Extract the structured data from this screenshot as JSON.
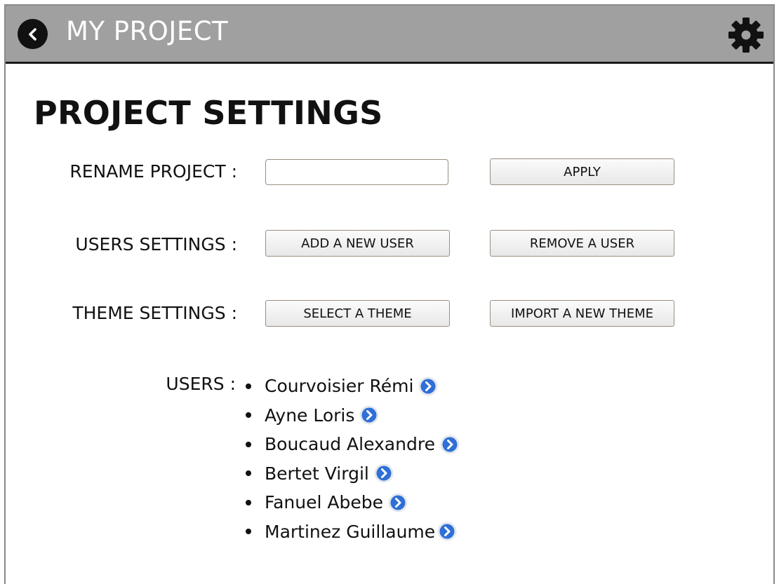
{
  "header": {
    "title": "MY PROJECT",
    "back_icon": "chevron-left-circle-icon",
    "settings_icon": "gear-icon"
  },
  "page": {
    "title": "PROJECT SETTINGS"
  },
  "rename": {
    "label": "RENAME PROJECT :",
    "input_value": "",
    "input_placeholder": "",
    "apply_label": "APPLY"
  },
  "users_settings": {
    "label": "USERS SETTINGS :",
    "add_label": "ADD A NEW USER",
    "remove_label": "REMOVE A USER"
  },
  "theme_settings": {
    "label": "THEME SETTINGS :",
    "select_label": "SELECT A THEME",
    "import_label": "IMPORT A NEW THEME"
  },
  "users": {
    "label": "USERS :",
    "item_icon": "chevron-right-circle-icon",
    "list": [
      {
        "name": "Courvoisier Rémi"
      },
      {
        "name": "Ayne Loris"
      },
      {
        "name": "Boucaud Alexandre"
      },
      {
        "name": "Bertet Virgil"
      },
      {
        "name": "Fanuel Abebe"
      },
      {
        "name": "Martinez Guillaume"
      }
    ]
  },
  "colors": {
    "header_bg": "#a0a0a0",
    "header_border": "#1a1a1a",
    "arrow_blue": "#2f6fd6"
  }
}
